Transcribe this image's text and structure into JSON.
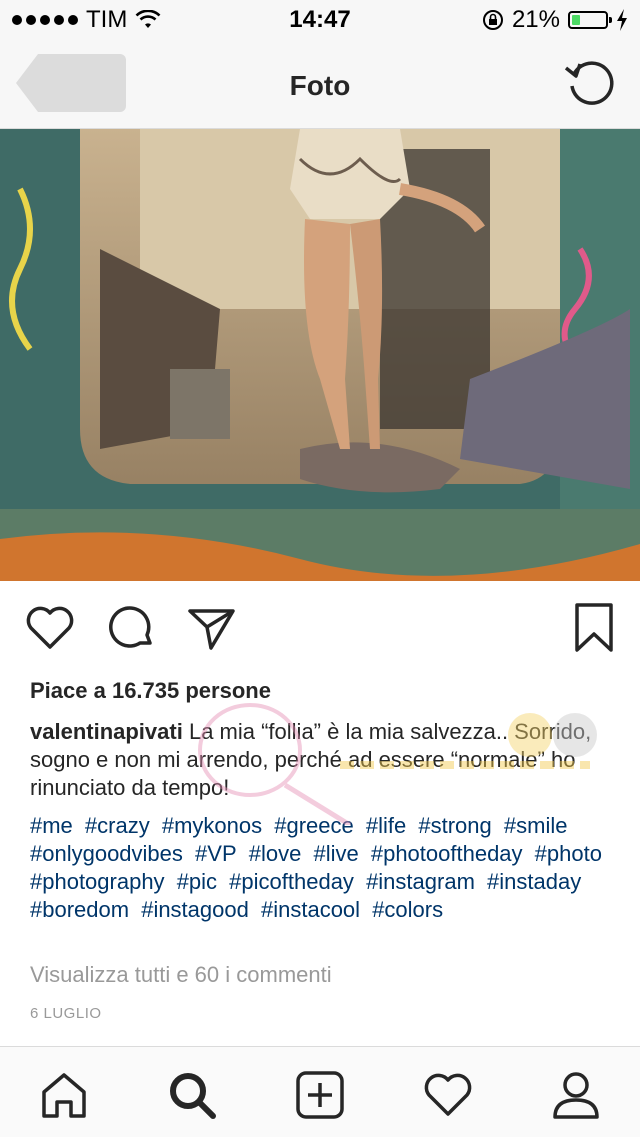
{
  "status_bar": {
    "carrier": "TIM",
    "time": "14:47",
    "battery_percent": "21%",
    "battery_level": 0.21
  },
  "nav": {
    "title": "Foto",
    "back_icon": "back-arrow-icon",
    "refresh_icon": "refresh-icon"
  },
  "post": {
    "likes_text": "Piace a 16.735 persone",
    "username": "valentinapivati",
    "caption_text": " La mia “follia” è la mia salvezza.. Sorrido, sogno e non mi arrendo, perché ad essere “normale” ho rinunciato da tempo!",
    "hashtags": [
      "#me",
      "#crazy",
      "#mykonos",
      "#greece",
      "#life",
      "#strong",
      "#smile",
      "#onlygoodvibes",
      "#VP",
      "#love",
      "#live",
      "#photooftheday",
      "#photo",
      "#photography",
      "#pic",
      "#picoftheday",
      "#instagram",
      "#instaday",
      "#boredom",
      "#instagood",
      "#instacool",
      "#colors"
    ],
    "view_comments": "Visualizza tutti e 60 i commenti",
    "date": "6 LUGLIO"
  },
  "actions": [
    "heart-icon",
    "comment-icon",
    "share-icon",
    "bookmark-icon"
  ],
  "tabbar": [
    "home-icon",
    "search-icon",
    "add-post-icon",
    "activity-heart-icon",
    "profile-icon"
  ],
  "colors": {
    "hashtag": "#003569",
    "muted": "#999999",
    "battery_fill": "#4cd964"
  }
}
